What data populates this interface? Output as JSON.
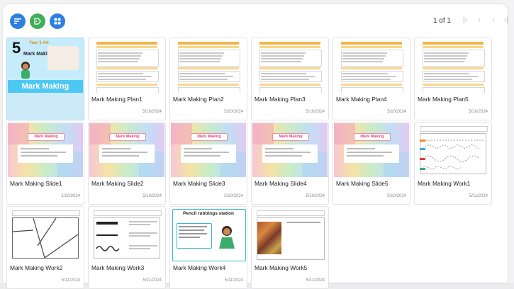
{
  "toolbar": {
    "buttons": [
      {
        "icon": "list-icon",
        "color": "#2f7fe0"
      },
      {
        "icon": "tag-icon",
        "color": "#3fae58"
      },
      {
        "icon": "grid-icon",
        "color": "#2f7fe0"
      }
    ]
  },
  "pager": {
    "text": "1 of 1",
    "first": "|‹",
    "prev": "‹",
    "next": "›",
    "last": "›|"
  },
  "items": [
    {
      "title": "",
      "date": "",
      "kind": "cover",
      "cover_year": "Year 1 Art",
      "cover_number": "5",
      "cover_heading": "Mark Making",
      "cover_band": "Mark Making"
    },
    {
      "title": "Mark Making Plan1",
      "date": "5/10/2024",
      "kind": "plan"
    },
    {
      "title": "Mark Making Plan2",
      "date": "5/10/2024",
      "kind": "plan"
    },
    {
      "title": "Mark Making Plan3",
      "date": "5/10/2024",
      "kind": "plan"
    },
    {
      "title": "Mark Making Plan4",
      "date": "5/10/2024",
      "kind": "plan"
    },
    {
      "title": "Mark Making Plan5",
      "date": "5/10/2024",
      "kind": "plan"
    },
    {
      "title": "Mark Making Slide1",
      "date": "5/10/2024",
      "kind": "slide",
      "sign": "Mark Making"
    },
    {
      "title": "Mark Making Slide2",
      "date": "5/10/2024",
      "kind": "slide",
      "sign": "Mark Making"
    },
    {
      "title": "Mark Making Slide3",
      "date": "5/10/2024",
      "kind": "slide",
      "sign": "Mark Making"
    },
    {
      "title": "Mark Making Slide4",
      "date": "5/10/2024",
      "kind": "slide",
      "sign": "Mark Making"
    },
    {
      "title": "Mark Making Slide5",
      "date": "5/10/2024",
      "kind": "slide",
      "sign": "Mark Making"
    },
    {
      "title": "Mark Making Work1",
      "date": "5/11/2024",
      "kind": "work1"
    },
    {
      "title": "Mark Making Work2",
      "date": "5/11/2024",
      "kind": "work2"
    },
    {
      "title": "Mark Making Work3",
      "date": "5/11/2024",
      "kind": "work3"
    },
    {
      "title": "Mark Making Work4",
      "date": "5/11/2024",
      "kind": "work4",
      "heading": "Pencil rubbings station"
    },
    {
      "title": "Mark Making Work5",
      "date": "5/11/2024",
      "kind": "work5"
    }
  ],
  "colors": {
    "selected_bg": "#cdeaf8",
    "plan_header": "#f5b547",
    "cover_band": "#4dc8f2"
  }
}
